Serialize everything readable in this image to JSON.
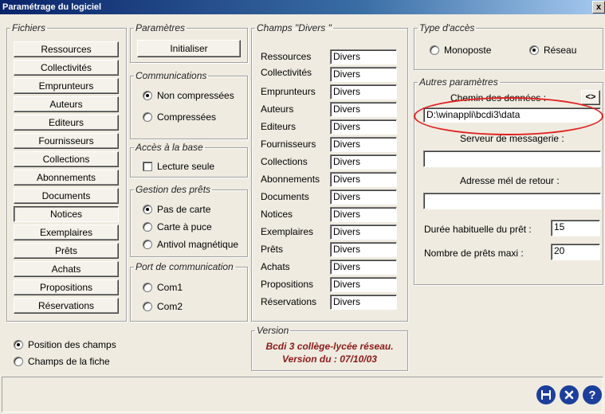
{
  "window": {
    "title": "Paramétrage du logiciel",
    "close_label": "x"
  },
  "fichiers": {
    "legend": "Fichiers",
    "buttons": [
      "Ressources",
      "Collectivités",
      "Emprunteurs",
      "Auteurs",
      "Editeurs",
      "Fournisseurs",
      "Collections",
      "Abonnements",
      "Documents",
      "Notices",
      "Exemplaires",
      "Prêts",
      "Achats",
      "Propositions",
      "Réservations"
    ],
    "selected": "Notices",
    "position_radios": [
      {
        "label": "Position des champs",
        "checked": true
      },
      {
        "label": "Champs de la fiche",
        "checked": false
      }
    ]
  },
  "parametres": {
    "legend": "Paramètres",
    "init_label": "Initialiser"
  },
  "communications": {
    "legend": "Communications",
    "options": [
      {
        "label": "Non compressées",
        "checked": true
      },
      {
        "label": "Compressées",
        "checked": false
      }
    ]
  },
  "acces_base": {
    "legend": "Accès à la base",
    "readonly_label": "Lecture seule",
    "readonly_checked": false
  },
  "gestion_prets": {
    "legend": "Gestion des prêts",
    "options": [
      {
        "label": "Pas de carte",
        "checked": true
      },
      {
        "label": "Carte à puce",
        "checked": false
      },
      {
        "label": "Antivol magnétique",
        "checked": false
      }
    ]
  },
  "port": {
    "legend": "Port de communication",
    "options": [
      {
        "label": "Com1",
        "checked": false
      },
      {
        "label": "Com2",
        "checked": false
      }
    ]
  },
  "champs_divers": {
    "legend": "Champs \"Divers \"",
    "rows": [
      {
        "label": "Ressources",
        "value": "Divers"
      },
      {
        "label": "Collectivités",
        "value": "Divers"
      },
      {
        "label": "Emprunteurs",
        "value": "Divers"
      },
      {
        "label": "Auteurs",
        "value": "Divers"
      },
      {
        "label": "Editeurs",
        "value": "Divers"
      },
      {
        "label": "Fournisseurs",
        "value": "Divers"
      },
      {
        "label": "Collections",
        "value": "Divers"
      },
      {
        "label": "Abonnements",
        "value": "Divers"
      },
      {
        "label": "Documents",
        "value": "Divers"
      },
      {
        "label": "Notices",
        "value": "Divers"
      },
      {
        "label": "Exemplaires",
        "value": "Divers"
      },
      {
        "label": "Prêts",
        "value": "Divers"
      },
      {
        "label": "Achats",
        "value": "Divers"
      },
      {
        "label": "Propositions",
        "value": "Divers"
      },
      {
        "label": "Réservations",
        "value": "Divers"
      }
    ]
  },
  "version": {
    "legend": "Version",
    "line1": "Bcdi 3 collège-lycée réseau.",
    "line2": "Version du : 07/10/03"
  },
  "type_acces": {
    "legend": "Type d'accès",
    "options": [
      {
        "label": "Monoposte",
        "checked": false
      },
      {
        "label": "Réseau",
        "checked": true
      }
    ]
  },
  "autres": {
    "legend": "Autres paramètres",
    "chemin_label": "Chemin des données :",
    "browse_label": "<>",
    "chemin_value": "D:\\winappli\\bcdi3\\data",
    "serveur_label": "Serveur de messagerie :",
    "serveur_value": "",
    "adresse_label": "Adresse mél de retour :",
    "adresse_value": "",
    "duree_label": "Durée habituelle du prêt :",
    "duree_value": "15",
    "nombre_label": "Nombre de prêts maxi :",
    "nombre_value": "20"
  },
  "toolbar": {
    "icons": [
      "save-icon",
      "cancel-icon",
      "help-icon"
    ]
  },
  "colors": {
    "annotation_ellipse": "#e02020",
    "version_text": "#8b1a1a",
    "icon_blue": "#1c3f9c"
  }
}
